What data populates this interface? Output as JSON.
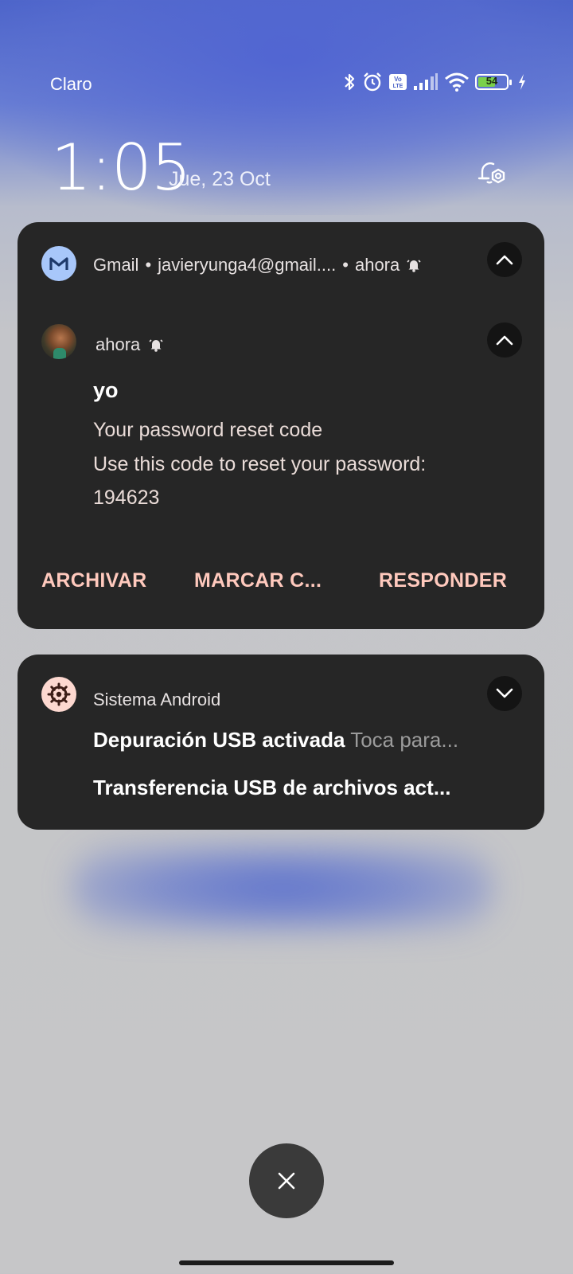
{
  "status_bar": {
    "carrier": "Claro",
    "battery_level": "54",
    "icons": [
      "bluetooth-icon",
      "alarm-icon",
      "volte-icon",
      "signal-icon",
      "wifi-icon",
      "battery-icon",
      "charging-icon"
    ]
  },
  "lockscreen": {
    "time": "1:05",
    "date": "Jue, 23 Oct"
  },
  "gmail_notification": {
    "app_name": "Gmail",
    "account": "javieryunga4@gmail....",
    "time": "ahora",
    "message_time": "ahora",
    "sender": "yo",
    "subject": "Your password reset code",
    "body_line": "Use this code to reset your password:",
    "code": "194623",
    "actions": [
      "ARCHIVAR",
      "MARCAR C...",
      "RESPONDER"
    ]
  },
  "android_notification": {
    "app_name": "Sistema Android",
    "item1_title": "Depuración USB activada",
    "item1_sub": "Toca para...",
    "item2_title": "Transferencia USB de archivos act..."
  },
  "colors": {
    "card_bg": "#262626",
    "action_text": "#ffc9bd",
    "battery_fill": "#7ad04a"
  }
}
